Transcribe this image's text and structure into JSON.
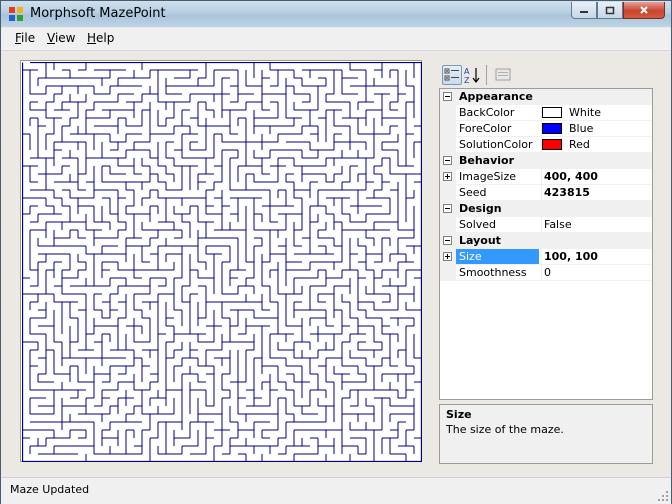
{
  "window": {
    "title": "Morphsoft MazePoint"
  },
  "menu": {
    "file": {
      "mnemonic": "F",
      "rest": "ile"
    },
    "view": {
      "mnemonic": "V",
      "rest": "iew"
    },
    "help": {
      "mnemonic": "H",
      "rest": "elp"
    }
  },
  "toolbar": {
    "icons": [
      "categorized-icon",
      "alphabetical-sort-icon",
      "property-pages-icon"
    ]
  },
  "property_grid": {
    "categories": [
      {
        "label": "Appearance",
        "properties": [
          {
            "name": "BackColor",
            "value": "White",
            "swatch": "#ffffff"
          },
          {
            "name": "ForeColor",
            "value": "Blue",
            "swatch": "#0000ff"
          },
          {
            "name": "SolutionColor",
            "value": "Red",
            "swatch": "#ff0000"
          }
        ]
      },
      {
        "label": "Behavior",
        "properties": [
          {
            "name": "ImageSize",
            "value": "400, 400",
            "bold": true,
            "expandable": true
          },
          {
            "name": "Seed",
            "value": "423815",
            "bold": true
          }
        ]
      },
      {
        "label": "Design",
        "properties": [
          {
            "name": "Solved",
            "value": "False"
          }
        ]
      },
      {
        "label": "Layout",
        "properties": [
          {
            "name": "Size",
            "value": "100, 100",
            "bold": true,
            "expandable": true,
            "selected": true
          },
          {
            "name": "Smoothness",
            "value": "0"
          }
        ]
      }
    ]
  },
  "help": {
    "title": "Size",
    "description": "The size of the maze."
  },
  "status": {
    "text": "Maze Updated"
  },
  "colors": {
    "maze_walls": "#000080",
    "selection": "#3399ff"
  }
}
